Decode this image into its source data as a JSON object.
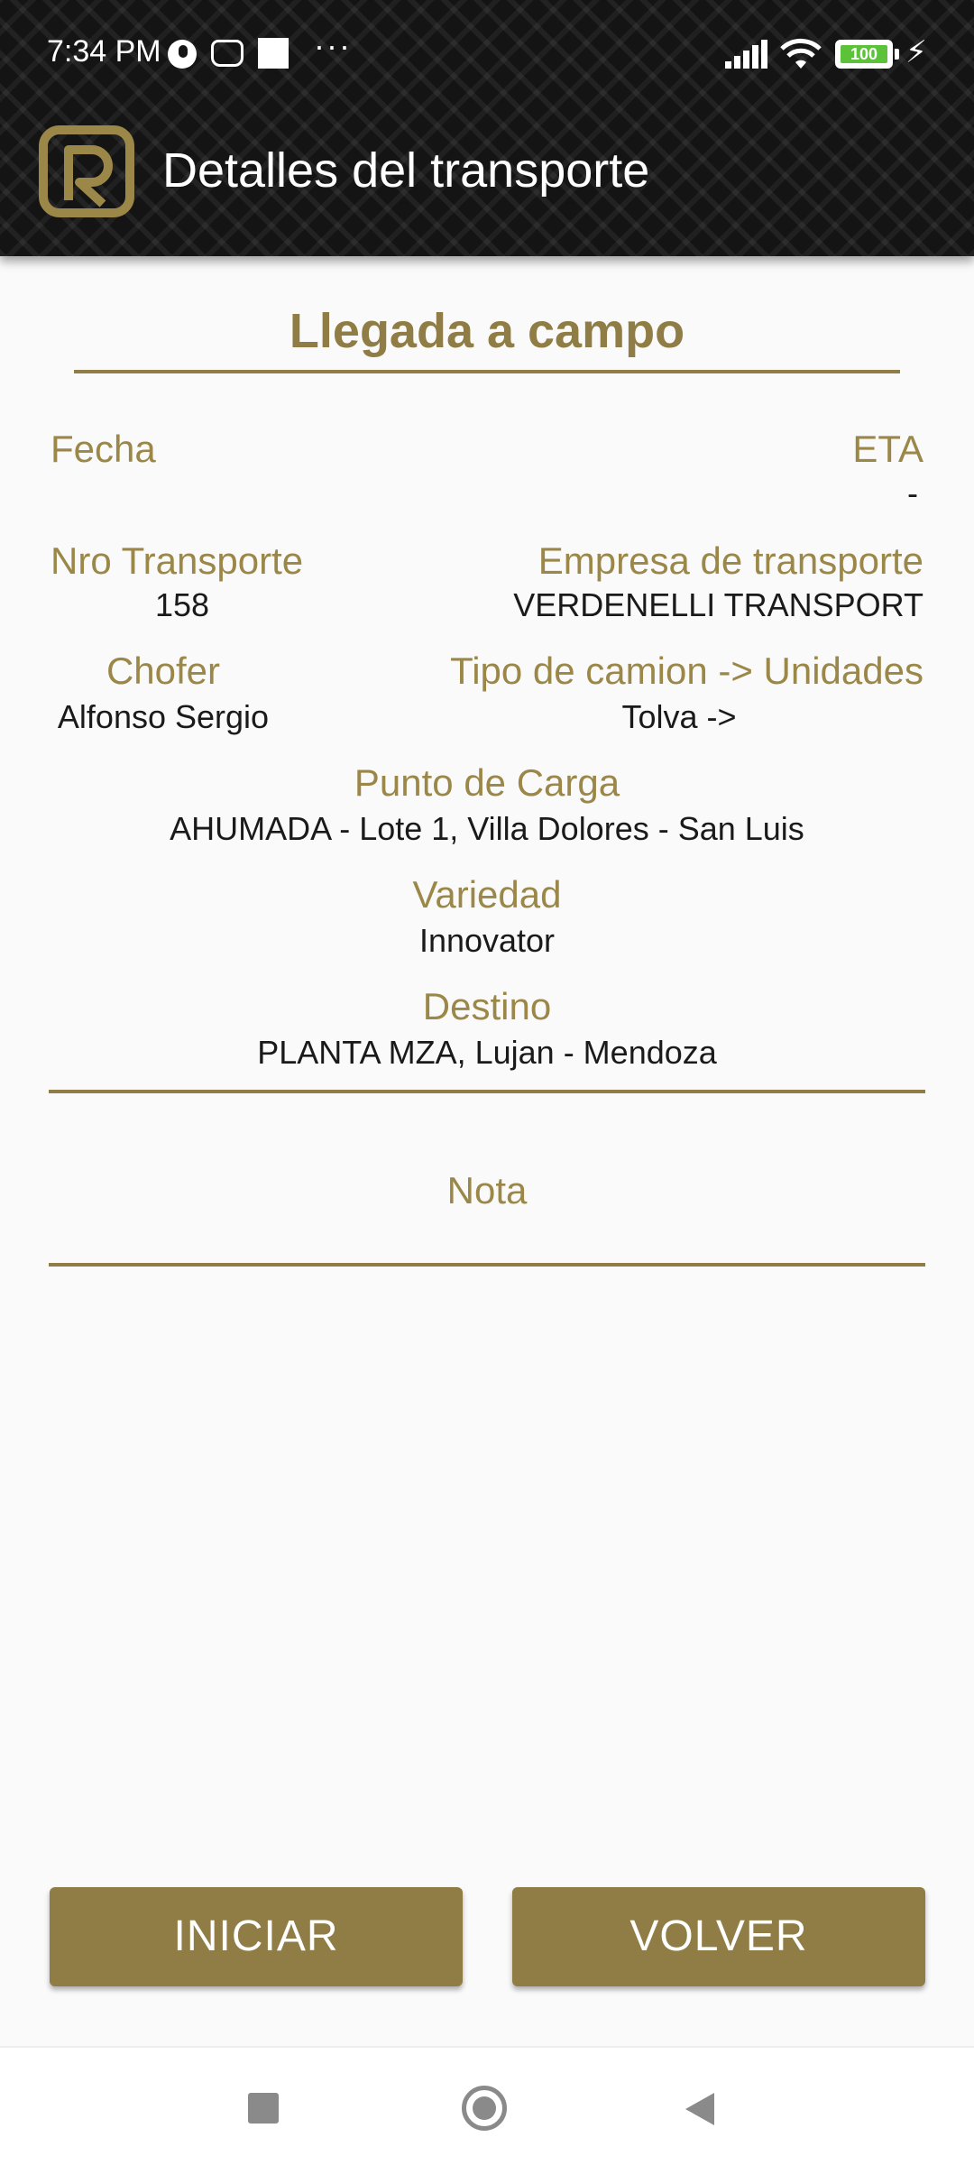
{
  "status_bar": {
    "time": "7:34 PM",
    "battery_level": "100",
    "more_indicator": "···"
  },
  "app_bar": {
    "title": "Detalles del transporte"
  },
  "section": {
    "title": "Llegada a campo"
  },
  "details": {
    "fecha_label": "Fecha",
    "fecha_value": "",
    "eta_label": "ETA",
    "eta_value": "-",
    "nro_transporte_label": "Nro Transporte",
    "nro_transporte_value": "158",
    "empresa_label": "Empresa de transporte",
    "empresa_value": "VERDENELLI TRANSPORT",
    "chofer_label": "Chofer",
    "chofer_value": "Alfonso Sergio",
    "tipo_camion_label": "Tipo de camion -> Unidades",
    "tipo_camion_value": "Tolva ->",
    "punto_carga_label": "Punto de Carga",
    "punto_carga_value": "AHUMADA - Lote 1, Villa Dolores - San Luis",
    "variedad_label": "Variedad",
    "variedad_value": "Innovator",
    "destino_label": "Destino",
    "destino_value": "PLANTA MZA, Lujan - Mendoza"
  },
  "nota": {
    "label": "Nota",
    "value": ""
  },
  "actions": {
    "iniciar_label": "INICIAR",
    "volver_label": "VOLVER"
  },
  "colors": {
    "accent": "#8f7d45",
    "label": "#9b8748",
    "header_bg": "#141414",
    "background": "#fafafa"
  }
}
